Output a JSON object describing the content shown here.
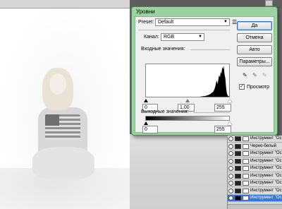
{
  "dialog": {
    "title": "Уровни",
    "preset_label": "Preset:",
    "preset_value": "Default",
    "preset_options_icon": "list-menu-icon",
    "channel_label": "Канал:",
    "channel_value": "RGB",
    "input_levels_label": "Входные значения:",
    "input_black": "0",
    "input_gamma": "1,00",
    "input_white": "255",
    "output_levels_label": "Выходные значения:",
    "output_black": "0",
    "output_white": "255",
    "buttons": {
      "ok": "Да",
      "cancel": "Отмена",
      "auto": "Авто",
      "options": "Параметры..."
    },
    "eyedroppers": [
      "eyedropper-black-icon",
      "eyedropper-gray-icon",
      "eyedropper-white-icon"
    ],
    "preview_label": "Просмотр",
    "preview_checked": true,
    "histogram": [
      0,
      0,
      0,
      0,
      0,
      0,
      0,
      0,
      0,
      0,
      0,
      0,
      0,
      0,
      0,
      0,
      0,
      0,
      0,
      0,
      0,
      0,
      0,
      0,
      0,
      0,
      0,
      0,
      0,
      0,
      0,
      0,
      0,
      0,
      0,
      0,
      0,
      0,
      0,
      0,
      0,
      0,
      0,
      0,
      0,
      0,
      0,
      0,
      0,
      0,
      0,
      0,
      0,
      0,
      0,
      0,
      0,
      0,
      0,
      0,
      0,
      0,
      0,
      0,
      0,
      0,
      0,
      0,
      0,
      0,
      0,
      0,
      1,
      1,
      1,
      2,
      2,
      2,
      3,
      3,
      4,
      5,
      6,
      7,
      8,
      10,
      12,
      14,
      16,
      20,
      26,
      34,
      46,
      52,
      40,
      58,
      70,
      62,
      80,
      74,
      96,
      88,
      100,
      72,
      60,
      30,
      12,
      4,
      2,
      1
    ]
  },
  "layers": {
    "rows": [
      {
        "name": "Инструмент \"Освет"
      },
      {
        "name": "Черно-белый"
      },
      {
        "name": "Инструмент \"Освет"
      },
      {
        "name": "Инструмент \"Освет"
      },
      {
        "name": "Инструмент \"Освет"
      },
      {
        "name": "Инструмент \"Освет"
      },
      {
        "name": "Инструмент \"Освет"
      },
      {
        "name": "Инструмент \"Освет"
      },
      {
        "name": "Инструмент \"Освет"
      }
    ],
    "active_index": 8
  },
  "window": {
    "close_icon": "close-icon"
  }
}
